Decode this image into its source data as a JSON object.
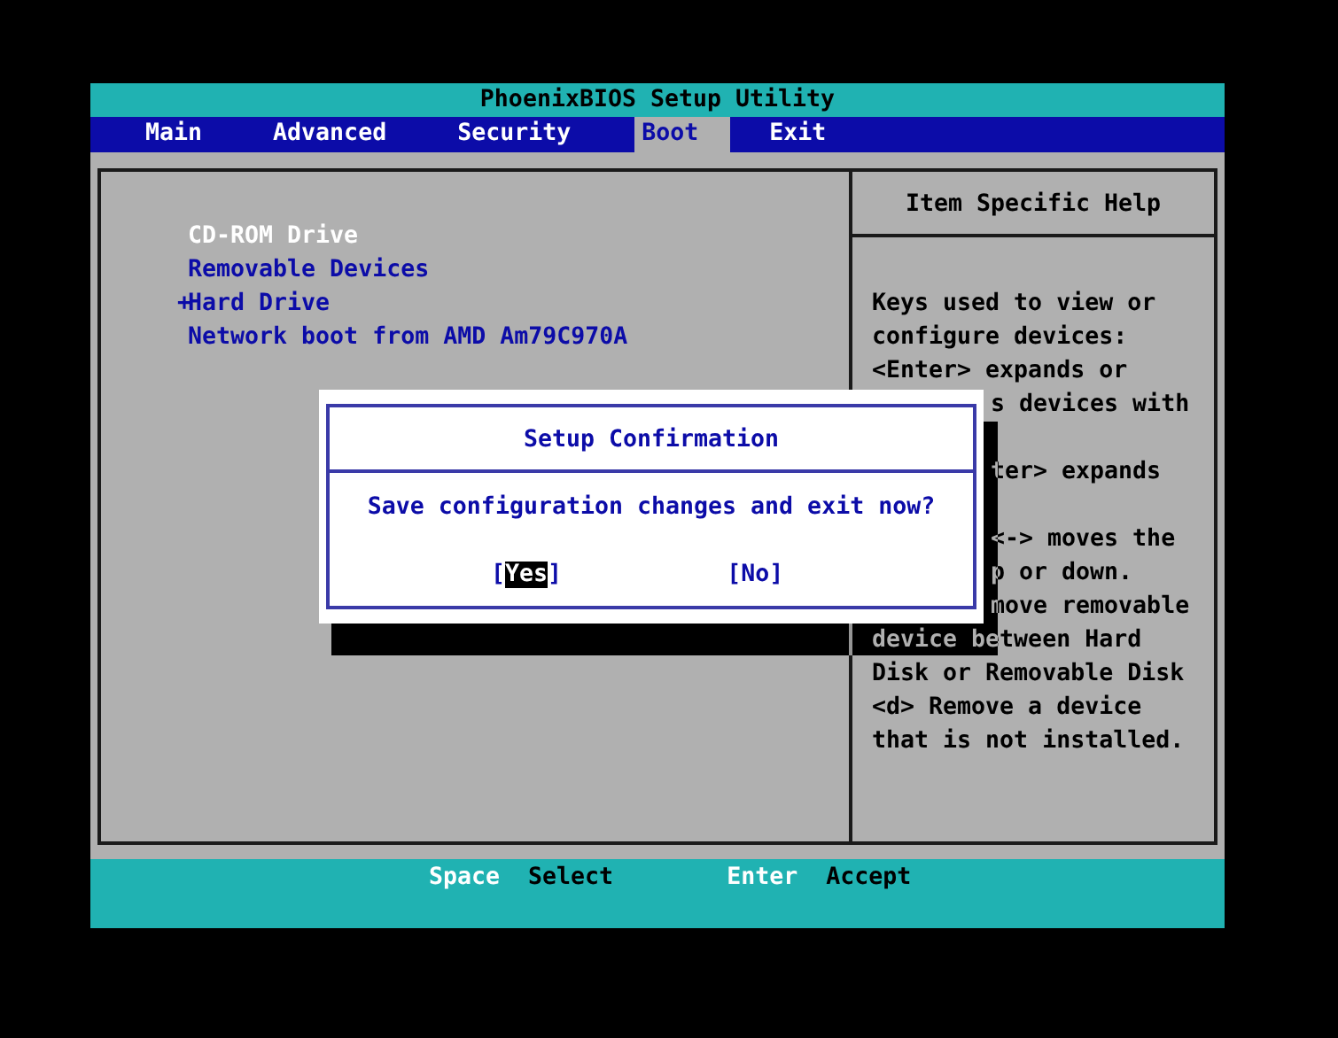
{
  "title": "PhoenixBIOS Setup Utility",
  "tabs": [
    {
      "label": "Main",
      "selected": false
    },
    {
      "label": "Advanced",
      "selected": false
    },
    {
      "label": "Security",
      "selected": false
    },
    {
      "label": "Boot",
      "selected": true
    },
    {
      "label": "Exit",
      "selected": false
    }
  ],
  "boot_items": [
    {
      "label": "CD-ROM Drive",
      "selected": true
    },
    {
      "label": "Removable Devices",
      "selected": false
    },
    {
      "label": "Hard Drive",
      "marker": "+",
      "selected": false
    },
    {
      "label": "Network boot from AMD Am79C970A",
      "selected": false
    }
  ],
  "help": {
    "title": "Item Specific Help",
    "lines": [
      {
        "text": "Keys used to view or",
        "kind": "full"
      },
      {
        "text": "configure devices:",
        "kind": "full"
      },
      {
        "text": "<Enter> expands or",
        "kind": "full"
      },
      {
        "text": "s devices with",
        "kind": "clipped"
      },
      {
        "text": "ter> expands",
        "kind": "clipped",
        "below_hidden_line": true
      },
      {
        "text": "<-> moves the",
        "kind": "clipped",
        "below_hidden_line": true
      },
      {
        "text": "p or down.",
        "kind": "clipped"
      },
      {
        "text": "move removable",
        "kind": "clipped"
      },
      {
        "text": "device between Hard",
        "kind": "full"
      },
      {
        "text": "Disk or Removable Disk",
        "kind": "full"
      },
      {
        "text": "<d> Remove a device",
        "kind": "full"
      },
      {
        "text": "that is not installed.",
        "kind": "full"
      }
    ]
  },
  "dialog": {
    "title": "Setup Confirmation",
    "message": "Save configuration changes and exit now?",
    "buttons": [
      {
        "label": "Yes",
        "brackets": [
          "[",
          "]"
        ],
        "selected": true
      },
      {
        "label": "No",
        "brackets": [
          "[",
          "]"
        ],
        "selected": false
      }
    ]
  },
  "status_bar": [
    {
      "key": "Space",
      "action": "Select"
    },
    {
      "key": "Enter",
      "action": "Accept"
    }
  ]
}
